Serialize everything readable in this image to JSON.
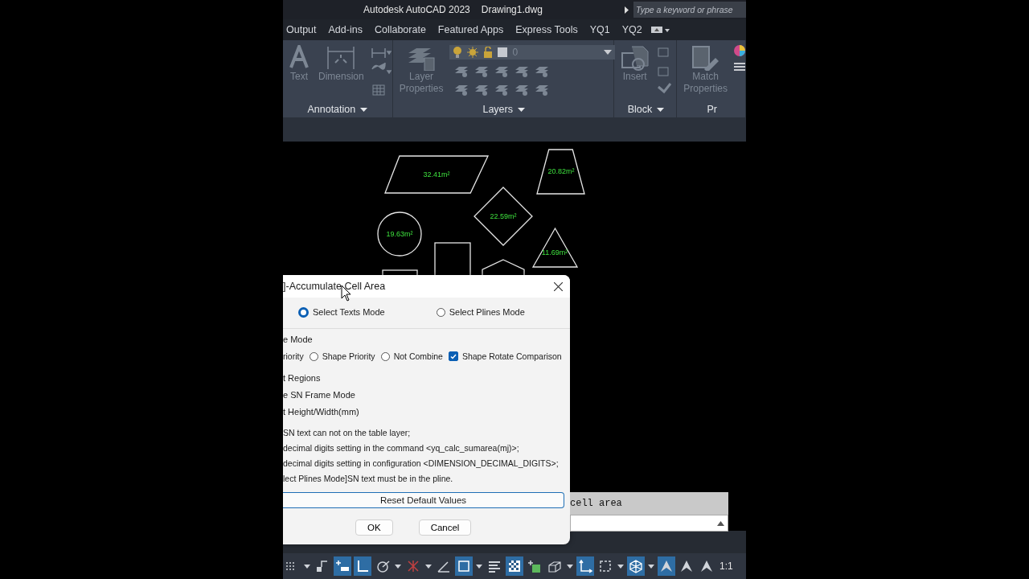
{
  "title_bar": {
    "app": "Autodesk AutoCAD 2023",
    "document": "Drawing1.dwg",
    "search": {
      "placeholder": "Type a keyword or phrase"
    }
  },
  "ribbon": {
    "tabs": [
      "Output",
      "Add-ins",
      "Collaborate",
      "Featured Apps",
      "Express Tools",
      "YQ1",
      "YQ2"
    ],
    "panels": [
      {
        "kind": "annotation",
        "title": "Annotation",
        "tools": [
          "Text",
          "Dimension"
        ]
      },
      {
        "kind": "layers",
        "title": "Layers",
        "tools": [
          "Layer Properties"
        ],
        "layer": "0"
      },
      {
        "kind": "block",
        "title": "Block",
        "tools": [
          "Insert"
        ]
      },
      {
        "kind": "properties",
        "title": "Pr",
        "tools": [
          "Match Properties"
        ]
      }
    ]
  },
  "drawing": {
    "shapes": [
      {
        "kind": "parallelogram",
        "label": "32.41m²"
      },
      {
        "kind": "trapezoid",
        "label": "20.82m²"
      },
      {
        "kind": "diamond",
        "label": "22.59m²"
      },
      {
        "kind": "circle",
        "label": "19.63m²"
      },
      {
        "kind": "triangle",
        "label": "11.69m²"
      },
      {
        "kind": "rectangle"
      },
      {
        "kind": "rectangle"
      },
      {
        "kind": "pentagon"
      }
    ]
  },
  "dialog": {
    "title": "]-Accumulate Cell Area",
    "modes": [
      {
        "label": "Select Texts Mode",
        "selected": true
      },
      {
        "label": "Select Plines Mode",
        "selected": false
      }
    ],
    "group_title": "e Mode",
    "combine_options": [
      {
        "kind": "text",
        "label": "riority"
      },
      {
        "kind": "radio",
        "label": "Shape Priority",
        "selected": false
      },
      {
        "kind": "radio",
        "label": "Not Combine",
        "selected": false
      },
      {
        "kind": "checkbox",
        "label": "Shape Rotate Comparison",
        "checked": true
      }
    ],
    "settings": [
      "t Regions",
      "e SN Frame Mode",
      "t Height/Width(mm)"
    ],
    "notes": [
      "SN text can not on the table layer;",
      "decimal digits setting in the command <yq_calc_sumarea(mj)>;",
      "decimal digits setting in configuration <DIMENSION_DECIMAL_DIGITS>;",
      "lect Plines Mode]SN text must be in the pline."
    ],
    "reset_button": "Reset Default Values",
    "buttons": [
      "OK",
      "Cancel"
    ]
  },
  "command_line": {
    "history": "cell area"
  },
  "status_bar": {
    "toggles": [
      {
        "kind": "grid",
        "on": false
      },
      {
        "kind": "snap",
        "on": false
      },
      {
        "kind": "infer",
        "on": true
      },
      {
        "kind": "ortho",
        "on": true
      },
      {
        "kind": "polar",
        "on": false
      },
      {
        "kind": "cross",
        "on": false
      },
      {
        "kind": "angle",
        "on": false
      },
      {
        "kind": "square",
        "on": true
      },
      {
        "kind": "lines",
        "on": false
      },
      {
        "kind": "checker",
        "on": true
      },
      {
        "kind": "cycle",
        "on": false
      },
      {
        "kind": "box",
        "on": false
      },
      {
        "kind": "ucs",
        "on": true
      },
      {
        "kind": "dashed",
        "on": false
      },
      {
        "kind": "gizmo",
        "on": true
      },
      {
        "kind": "annotate",
        "on": true
      },
      {
        "kind": "annotate",
        "on": false
      },
      {
        "kind": "annotate",
        "on": false
      }
    ],
    "scale": "1:1"
  }
}
